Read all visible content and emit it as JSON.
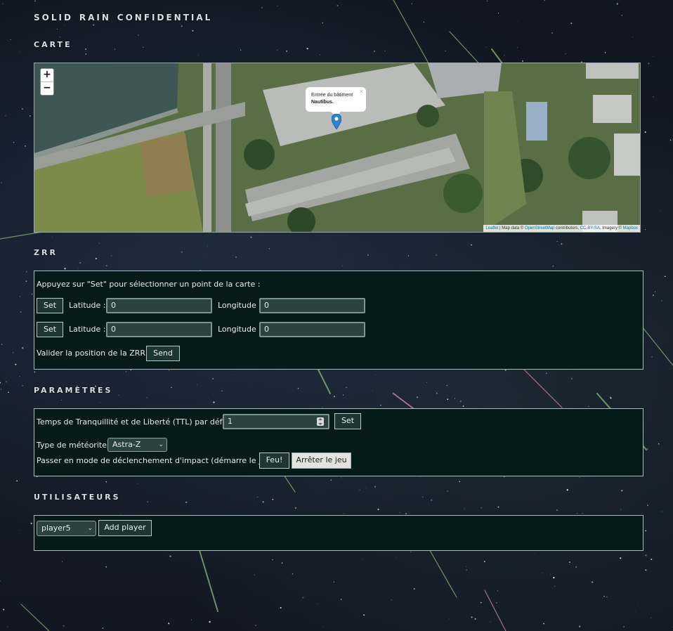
{
  "app_title": "solid rain confidential",
  "sections": {
    "map": "carte",
    "zrr": "zrr",
    "params": "paramètres",
    "users": "utilisateurs"
  },
  "map": {
    "zoom_in": "+",
    "zoom_out": "−",
    "popup_line1": "Entrée du bâtiment",
    "popup_line2": "Nautibus.",
    "popup_close": "×",
    "attribution": {
      "leaflet": "Leaflet",
      "sep1": " | Map data © ",
      "osm": "OpenStreetMap",
      "sep2": " contributors, ",
      "license": "CC-BY-SA",
      "sep3": ", Imagery © ",
      "mapbox": "Mapbox"
    }
  },
  "zrr": {
    "instruction": "Appuyez sur \"Set\" pour sélectionner un point de la carte :",
    "set_label": "Set",
    "lat_label": "Latitude :",
    "lng_label": "Longitude :",
    "point1": {
      "lat": "0",
      "lng": "0"
    },
    "point2": {
      "lat": "0",
      "lng": "0"
    },
    "validate_label": "Valider la position de la ZRR :",
    "send_label": "Send"
  },
  "params": {
    "ttl_label": "Temps de Tranquillité et de Liberté (TTL) par défaut :",
    "ttl_value": "1",
    "ttl_set": "Set",
    "meteor_label": "Type de météorite :",
    "meteor_value": "Astra-Z",
    "impact_label": "Passer en mode de déclenchement d'impact (démarre le jeu) :",
    "fire_label": "Feu!",
    "stop_label": "Arrêter le jeu"
  },
  "users": {
    "selected_player": "player5",
    "add_label": "Add player"
  }
}
